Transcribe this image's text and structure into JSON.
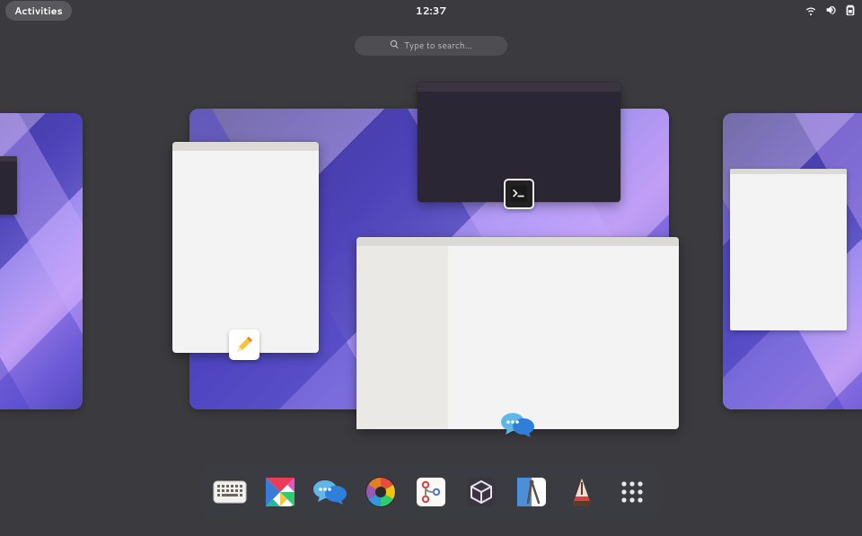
{
  "topbar": {
    "activities_label": "Activities",
    "time": "12:37"
  },
  "search": {
    "placeholder": "Type to search…"
  },
  "status_icons": [
    "network-wireless-icon",
    "volume-icon",
    "power-icon"
  ],
  "overview_windows": [
    {
      "app": "terminal",
      "icon": "terminal-icon"
    },
    {
      "app": "text-editor",
      "icon": "text-editor-icon"
    },
    {
      "app": "chat",
      "icon": "chat-icon"
    }
  ],
  "dash": {
    "items": [
      {
        "name": "keyboard-app",
        "icon": "keyboard-icon"
      },
      {
        "name": "tangram-app",
        "icon": "tangram-icon"
      },
      {
        "name": "chat-app",
        "icon": "chat-icon"
      },
      {
        "name": "aperture-app",
        "icon": "aperture-icon"
      },
      {
        "name": "gitg-app",
        "icon": "git-branch-icon"
      },
      {
        "name": "boxes-app",
        "icon": "boxes-icon"
      },
      {
        "name": "tools-app",
        "icon": "compass-icon"
      },
      {
        "name": "metronome-app",
        "icon": "metronome-icon"
      },
      {
        "name": "show-apps",
        "icon": "grid-icon"
      }
    ]
  }
}
